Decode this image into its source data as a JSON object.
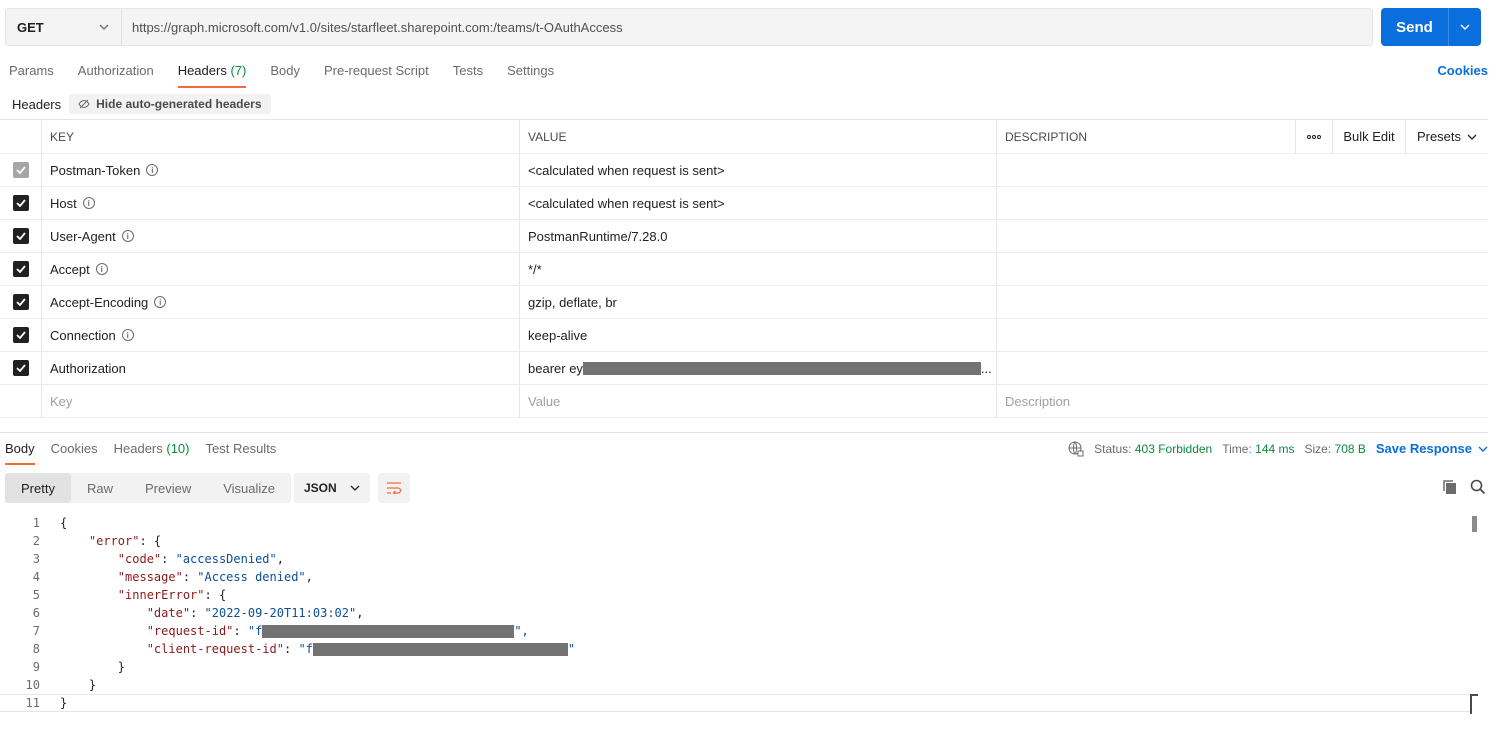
{
  "request": {
    "method": "GET",
    "url": "https://graph.microsoft.com/v1.0/sites/starfleet.sharepoint.com:/teams/t-OAuthAccess",
    "send_label": "Send"
  },
  "req_tabs": {
    "params": "Params",
    "authorization": "Authorization",
    "headers": "Headers",
    "headers_count": "(7)",
    "body": "Body",
    "prerequest": "Pre-request Script",
    "tests": "Tests",
    "settings": "Settings",
    "cookies": "Cookies"
  },
  "headers_section": {
    "label": "Headers",
    "hide_button": "Hide auto-generated headers"
  },
  "table": {
    "col_key": "KEY",
    "col_value": "VALUE",
    "col_description": "DESCRIPTION",
    "more": "ooo",
    "bulk_edit": "Bulk Edit",
    "presets": "Presets",
    "rows": [
      {
        "key": "Postman-Token",
        "value": "<calculated when request is sent>"
      },
      {
        "key": "Host",
        "value": "<calculated when request is sent>"
      },
      {
        "key": "User-Agent",
        "value": "PostmanRuntime/7.28.0"
      },
      {
        "key": "Accept",
        "value": "*/*"
      },
      {
        "key": "Accept-Encoding",
        "value": "gzip, deflate, br"
      },
      {
        "key": "Connection",
        "value": "keep-alive"
      },
      {
        "key": "Authorization",
        "value": "bearer ey",
        "value_suffix": "..."
      }
    ],
    "placeholder_key": "Key",
    "placeholder_value": "Value",
    "placeholder_description": "Description"
  },
  "response": {
    "tabs": {
      "body": "Body",
      "cookies": "Cookies",
      "headers": "Headers",
      "headers_count": "(10)",
      "test_results": "Test Results"
    },
    "status_label": "Status:",
    "status_value": "403 Forbidden",
    "time_label": "Time:",
    "time_value": "144 ms",
    "size_label": "Size:",
    "size_value": "708 B",
    "save_response": "Save Response",
    "view_tabs": {
      "pretty": "Pretty",
      "raw": "Raw",
      "preview": "Preview",
      "visualize": "Visualize"
    },
    "format": "JSON"
  },
  "code": {
    "line_numbers": [
      "1",
      "2",
      "3",
      "4",
      "5",
      "6",
      "7",
      "8",
      "9",
      "10",
      "11"
    ],
    "l1": "{",
    "l2_key": "\"error\"",
    "l2_rest": ": {",
    "l3_key": "\"code\"",
    "l3_sep": ": ",
    "l3_val": "\"accessDenied\"",
    "l4_key": "\"message\"",
    "l4_sep": ": ",
    "l4_val": "\"Access denied\"",
    "l5_key": "\"innerError\"",
    "l5_rest": ": {",
    "l6_key": "\"date\"",
    "l6_sep": ": ",
    "l6_val": "\"2022-09-20T11:03:02\"",
    "l7_key": "\"request-id\"",
    "l7_sep": ": ",
    "l7_val_start": "\"f",
    "l7_val_end": "\",",
    "l8_key": "\"client-request-id\"",
    "l8_sep": ": ",
    "l8_val_start": "\"f",
    "l8_val_end": "\"",
    "l9": "}",
    "l10": "}",
    "l11": "}"
  },
  "colors": {
    "accent_blue": "#0a6edc",
    "tab_underline": "#f26b3a",
    "status_green": "#0c8a3e"
  }
}
